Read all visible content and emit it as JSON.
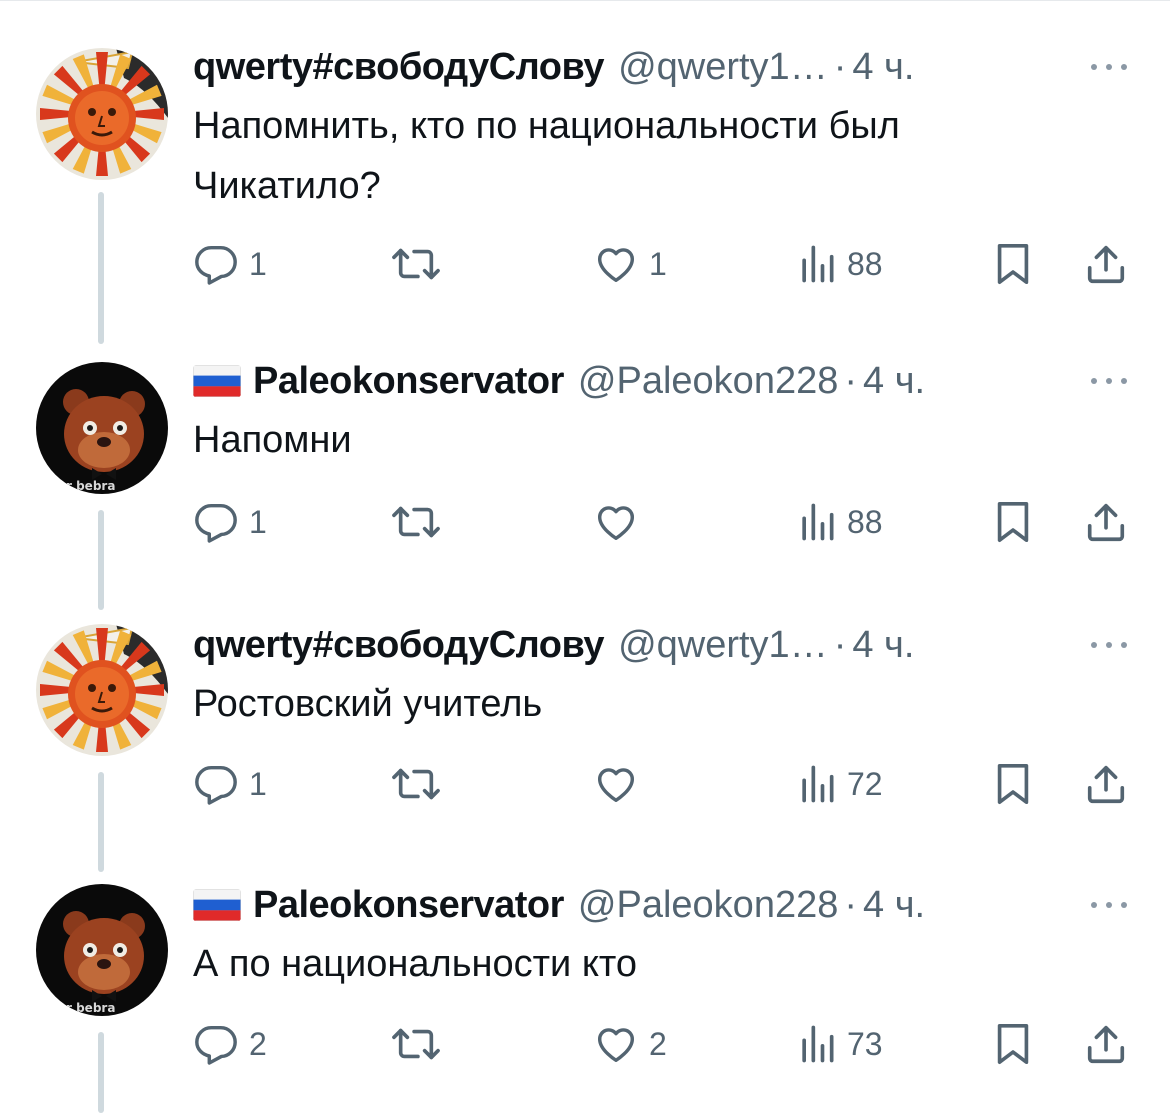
{
  "tweets": [
    {
      "display_name": "qwerty#свободуСлову",
      "handle": "@qwerty1…",
      "separator": "·",
      "time": "4 ч.",
      "text": "Напомнить, кто по национальности был\nЧикатило?",
      "avatar": "sun-avatar",
      "flag": "",
      "counts": {
        "replies": "1",
        "retweets": "",
        "likes": "1",
        "views": "88"
      }
    },
    {
      "display_name": "Paleokonservator",
      "handle": "@Paleokon228",
      "separator": "·",
      "time": "4 ч.",
      "text": "Напомни",
      "avatar": "bear-avatar",
      "avatar_caption": "r bebra",
      "flag": "russia-flag",
      "counts": {
        "replies": "1",
        "retweets": "",
        "likes": "",
        "views": "88"
      }
    },
    {
      "display_name": "qwerty#свободуСлову",
      "handle": "@qwerty1…",
      "separator": "·",
      "time": "4 ч.",
      "text": "Ростовский учитель",
      "avatar": "sun-avatar",
      "flag": "",
      "counts": {
        "replies": "1",
        "retweets": "",
        "likes": "",
        "views": "72"
      }
    },
    {
      "display_name": "Paleokonservator",
      "handle": "@Paleokon228",
      "separator": "·",
      "time": "4 ч.",
      "text": "А по национальности кто",
      "avatar": "bear-avatar",
      "avatar_caption": "r bebra",
      "flag": "russia-flag",
      "counts": {
        "replies": "2",
        "retweets": "",
        "likes": "2",
        "views": "73"
      }
    }
  ],
  "icons": {
    "reply": "reply-icon",
    "retweet": "retweet-icon",
    "like": "like-icon",
    "views": "views-icon",
    "bookmark": "bookmark-icon",
    "share": "share-icon",
    "more": "more-icon"
  },
  "colors": {
    "text": "#0f1419",
    "secondary": "#536471",
    "thread": "#cfd9de"
  }
}
